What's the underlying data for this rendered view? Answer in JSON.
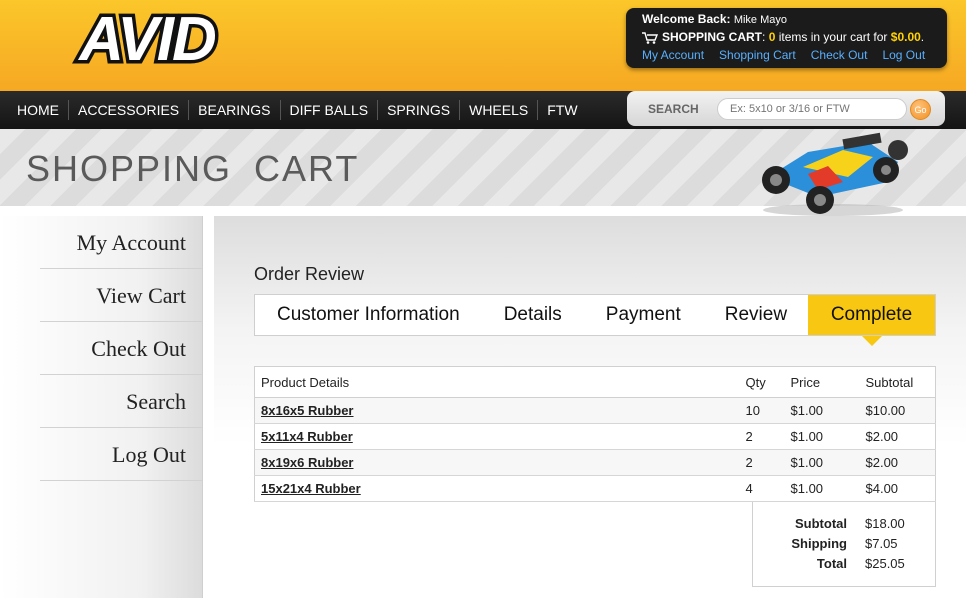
{
  "header": {
    "logo_text": "AVID",
    "welcome_label": "Welcome Back:",
    "user_name": "Mike Mayo",
    "cart_label": "SHOPPING CART",
    "cart_count": "0",
    "cart_mid_text": "items in your cart for",
    "cart_total": "$0.00",
    "links": [
      "My Account",
      "Shopping Cart",
      "Check Out",
      "Log Out"
    ]
  },
  "nav": {
    "items": [
      "HOME",
      "ACCESSORIES",
      "BEARINGS",
      "DIFF BALLS",
      "SPRINGS",
      "WHEELS",
      "FTW"
    ]
  },
  "search": {
    "label": "SEARCH",
    "placeholder": "Ex: 5x10 or 3/16 or FTW",
    "go_label": "Go"
  },
  "banner": {
    "title": "SHOPPING CART"
  },
  "sidebar": {
    "items": [
      "My Account",
      "View Cart",
      "Check Out",
      "Search",
      "Log Out"
    ]
  },
  "order": {
    "title": "Order Review",
    "steps": [
      "Customer Information",
      "Details",
      "Payment",
      "Review",
      "Complete"
    ],
    "active_step": "Complete",
    "columns": [
      "Product Details",
      "Qty",
      "Price",
      "Subtotal"
    ],
    "rows": [
      {
        "name": "8x16x5 Rubber",
        "qty": "10",
        "price": "$1.00",
        "subtotal": "$10.00"
      },
      {
        "name": "5x11x4 Rubber",
        "qty": "2",
        "price": "$1.00",
        "subtotal": "$2.00"
      },
      {
        "name": "8x19x6 Rubber",
        "qty": "2",
        "price": "$1.00",
        "subtotal": "$2.00"
      },
      {
        "name": "15x21x4 Rubber",
        "qty": "4",
        "price": "$1.00",
        "subtotal": "$4.00"
      }
    ],
    "totals": {
      "subtotal_label": "Subtotal",
      "subtotal": "$18.00",
      "shipping_label": "Shipping",
      "shipping": "$7.05",
      "total_label": "Total",
      "total": "$25.05"
    }
  },
  "colors": {
    "brand_orange": "#f6a823",
    "accent_yellow": "#f8c711",
    "link_blue": "#58b0ff"
  }
}
